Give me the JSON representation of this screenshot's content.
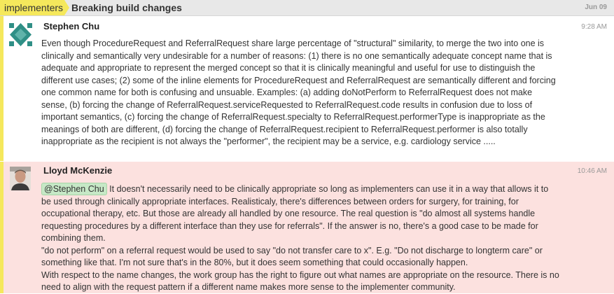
{
  "header": {
    "stream": "implementers",
    "topic": "Breaking build changes",
    "date": "Jun 09"
  },
  "colors": {
    "stream_yellow": "#f5e85c",
    "highlight_pink": "#fce1df",
    "mention_green": "#c6e8c6"
  },
  "messages": [
    {
      "sender": "Stephen Chu",
      "time": "9:28 AM",
      "avatar_icon": "geometric-identicon",
      "paragraphs": [
        "Even though ProcedureRequest and ReferralRequest share large percentage of \"structural\" similarity, to merge the two into one is clinically and semantically very undesirable for a number of reasons: (1) there is no one semantically adequate concept name that is adequate and appropriate to represent the merged concept so that it is clinically meaningful and useful for use to distinguish the different use cases; (2) some of the inline elements for ProcedureRequest and ReferralRequest are semantically different and forcing one common name for both is confusing and unsuable. Examples: (a) adding doNotPerform to ReferralRequest does not make sense, (b) forcing the change of ReferralRequest.serviceRequested to ReferralRequest.code results in confusion due to loss of important semantics, (c) forcing the change of ReferralRequest.specialty to ReferralRequest.performerType is inappropriate as the meanings of both are different, (d) forcing the change of ReferralRequest.recipient to ReferralRequest.performer is also totally inappropriate as the recipient is not always the \"performer\", the recipient may be a service, e.g. cardiology service ....."
      ]
    },
    {
      "sender": "Lloyd McKenzie",
      "time": "10:46 AM",
      "avatar_icon": "user-photo",
      "mention": "@Stephen Chu",
      "paragraphs": [
        " It doesn't necessarily need to be clinically appropriate so long as implementers can use it in a way that allows it to be used through clinically appropriate interfaces. Realisticaly, there's differences between orders for surgery, for training, for occupational therapy, etc. But those are already all handled by one resource. The real question is \"do almost all systems handle requesting procedures by a different interface than they use for referrals\". If the answer is no, there's a good case to be made for combining them.",
        "\"do not perform\" on a referral request would be used to say \"do not transfer care to x\". E.g. \"Do not discharge to longterm care\" or something like that. I'm not sure that's in the 80%, but it does seem something that could occasionally happen.",
        "With respect to the name changes, the work group has the right to figure out what names are appropriate on the resource. There is no need to align with the request pattern if a different name makes more sense to the implementer community."
      ]
    }
  ]
}
